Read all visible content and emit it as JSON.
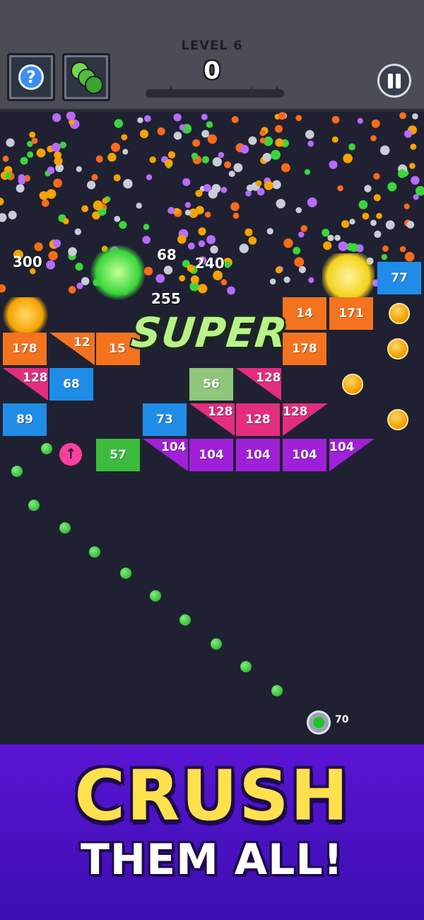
{
  "hud": {
    "level_label": "LEVEL 6",
    "score": "0",
    "help_glyph": "?",
    "stars_total": 3,
    "stars_earned": 0
  },
  "playfield": {
    "super_text": "SUPER",
    "floating_scores": [
      "300",
      "68",
      "240",
      "255"
    ],
    "bricks_row1": [
      "178",
      "12",
      "15",
      "178",
      "14",
      "171",
      "77"
    ],
    "bricks_row2": [
      "128",
      "68",
      "56",
      "128"
    ],
    "bricks_row3": [
      "89",
      "73",
      "128",
      "128",
      "128"
    ],
    "bricks_row4": [
      "57",
      "104",
      "104",
      "104",
      "104",
      "104"
    ],
    "ball_count": "70"
  },
  "banner": {
    "headline": "CRUSH",
    "subline": "THEM ALL!"
  },
  "colors": {
    "orange": "#f5731f",
    "blue": "#1f8de8",
    "pink": "#e32e7d",
    "purple": "#a020d8",
    "green": "#3dbb3d",
    "olive": "#8fc67a",
    "gold": "#f5a300"
  }
}
